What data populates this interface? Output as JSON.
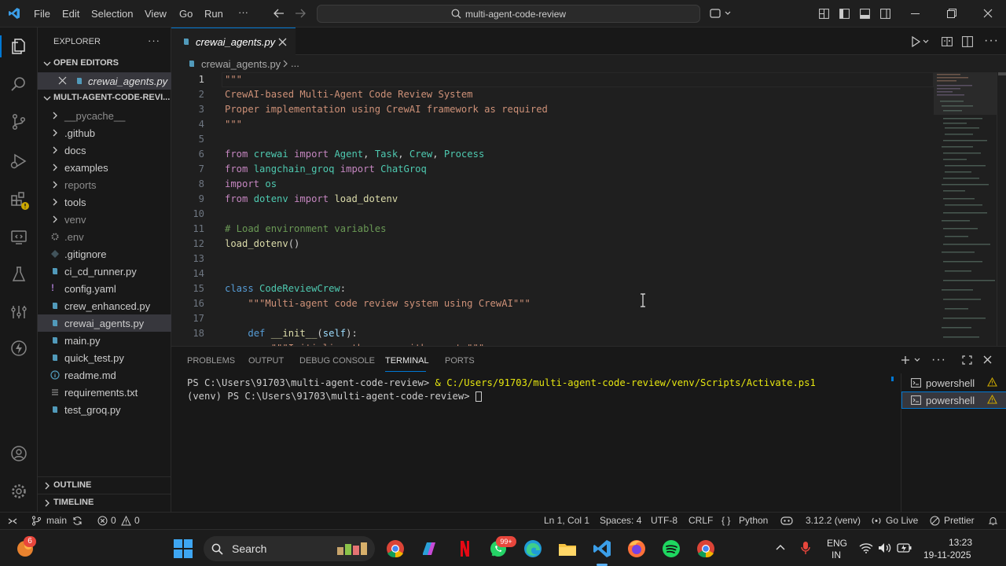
{
  "titlebar": {
    "menu": [
      "File",
      "Edit",
      "Selection",
      "View",
      "Go",
      "Run",
      "···"
    ],
    "search": "multi-agent-code-review"
  },
  "sidebar": {
    "title": "EXPLORER",
    "open_editors_header": "OPEN EDITORS",
    "open_editor": "crewai_agents.py",
    "project_header": "MULTI-AGENT-CODE-REVI...",
    "folders": [
      "__pycache__",
      ".github",
      "docs",
      "examples",
      "reports",
      "tools",
      "venv"
    ],
    "files": [
      ".env",
      ".gitignore",
      "ci_cd_runner.py",
      "config.yaml",
      "crew_enhanced.py",
      "crewai_agents.py",
      "main.py",
      "quick_test.py",
      "readme.md",
      "requirements.txt",
      "test_groq.py"
    ],
    "outline": "OUTLINE",
    "timeline": "TIMELINE"
  },
  "editor": {
    "tab": "crewai_agents.py",
    "breadcrumb_file": "crewai_agents.py",
    "breadcrumb_more": "...",
    "line_numbers": [
      "1",
      "2",
      "3",
      "4",
      "5",
      "6",
      "7",
      "8",
      "9",
      "10",
      "11",
      "12",
      "13",
      "14",
      "15",
      "16",
      "17",
      "18"
    ]
  },
  "panel": {
    "tabs": [
      "PROBLEMS",
      "OUTPUT",
      "DEBUG CONSOLE",
      "TERMINAL",
      "PORTS"
    ],
    "terminal_line1_prompt": "PS C:\\Users\\91703\\multi-agent-code-review> ",
    "terminal_line1_cmd": "& C:/Users/91703/multi-agent-code-review/venv/Scripts/Activate.ps1",
    "terminal_line2": "(venv) PS C:\\Users\\91703\\multi-agent-code-review> ",
    "terminals": [
      "powershell",
      "powershell"
    ]
  },
  "statusbar": {
    "branch": "main",
    "errors": "0",
    "warnings": "0",
    "position": "Ln 1, Col 1",
    "spaces": "Spaces: 4",
    "encoding": "UTF-8",
    "eol": "CRLF",
    "language": "Python",
    "interpreter": "3.12.2 (venv)",
    "golive": "Go Live",
    "prettier": "Prettier"
  },
  "taskbar": {
    "search": "Search",
    "badge": "6",
    "whatsapp_badge": "99+",
    "lang1": "ENG",
    "lang2": "IN",
    "time": "13:23",
    "date": "19-11-2025"
  },
  "colors": {
    "accent": "#0078d4",
    "string": "#ce9178",
    "keyword": "#c586c0",
    "module": "#4ec9b0",
    "function": "#dcdcaa",
    "comment": "#6a9955"
  }
}
